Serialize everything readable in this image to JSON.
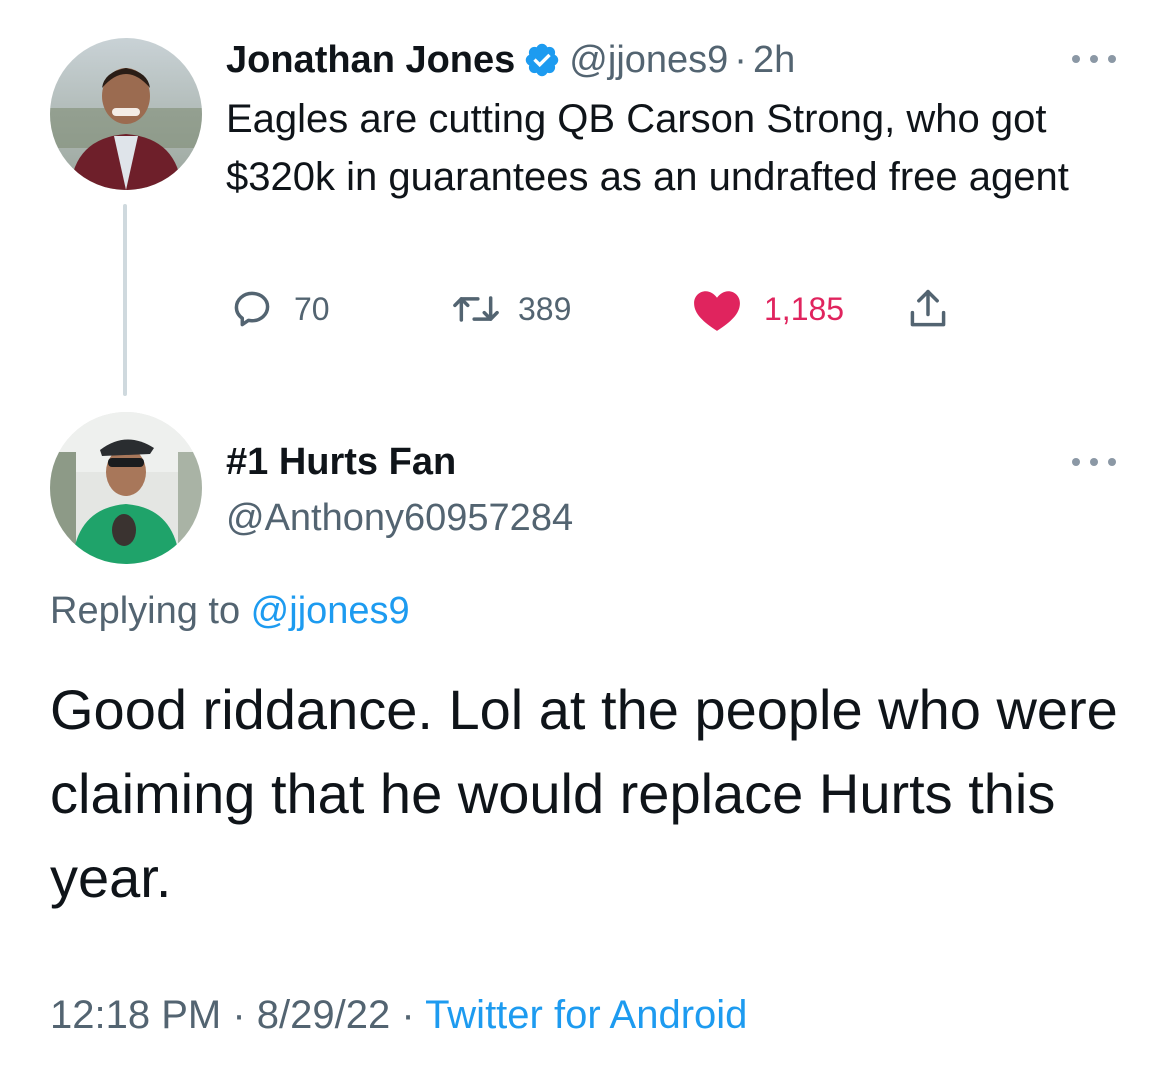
{
  "parent_tweet": {
    "author_name": "Jonathan Jones",
    "handle": "@jjones9",
    "separator": "·",
    "time_ago": "2h",
    "text": "Eagles are cutting QB Carson Strong, who got $320k in guarantees as an undrafted free agent",
    "replies": "70",
    "retweets": "389",
    "likes": "1,185",
    "liked": true,
    "icons": [
      "verified-badge-icon",
      "reply-icon",
      "retweet-icon",
      "heart-icon",
      "share-icon",
      "more-options-icon"
    ]
  },
  "reply_tweet": {
    "author_name": "#1 Hurts Fan",
    "handle": "@Anthony60957284",
    "replying_prefix": "Replying to ",
    "replying_to": "@jjones9",
    "text": "Good riddance. Lol at the people who were claiming that he would replace Hurts this year.",
    "time": "12:18 PM",
    "dot1": " · ",
    "date": "8/29/22",
    "dot2": " · ",
    "source": "Twitter for Android"
  },
  "colors": {
    "text": "#0f1419",
    "muted": "#536471",
    "link": "#1d9bf0",
    "like": "#e0245e",
    "verified": "#1d9bf0",
    "thread_line": "#cfd9de"
  }
}
